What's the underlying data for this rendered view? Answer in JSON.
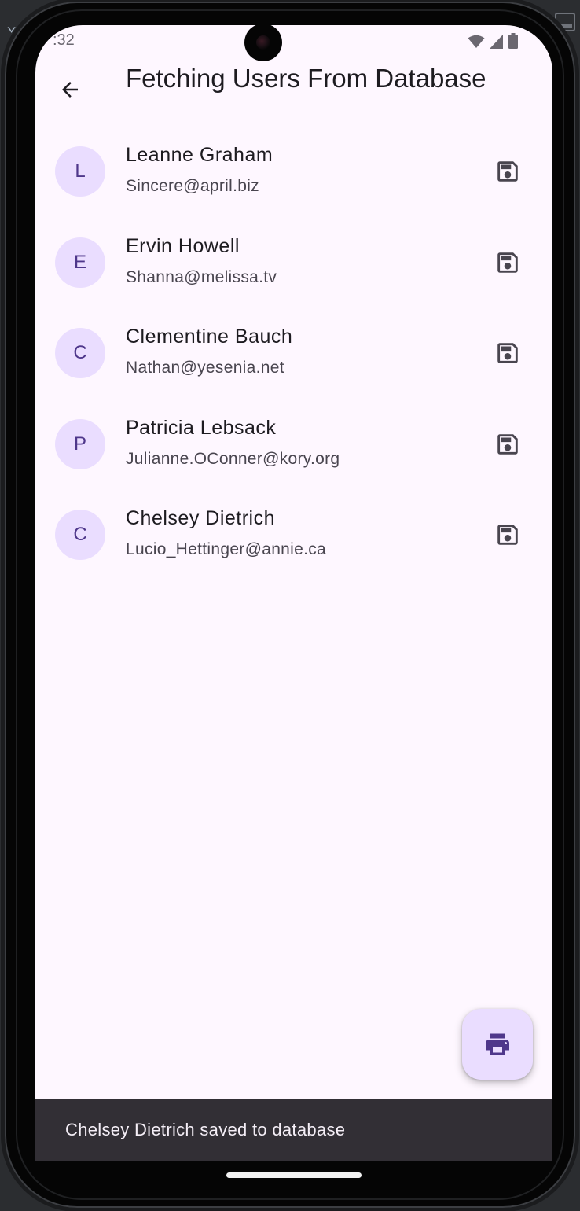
{
  "status_bar": {
    "time": ":32",
    "icons": [
      "wifi-icon",
      "cellular-signal-icon",
      "battery-icon"
    ]
  },
  "app_bar": {
    "back_icon": "arrow-back-icon",
    "title": "Fetching Users From Database"
  },
  "users": [
    {
      "initial": "L",
      "name": "Leanne Graham",
      "email": "Sincere@april.biz",
      "action_icon": "save-icon"
    },
    {
      "initial": "E",
      "name": "Ervin Howell",
      "email": "Shanna@melissa.tv",
      "action_icon": "save-icon"
    },
    {
      "initial": "C",
      "name": "Clementine Bauch",
      "email": "Nathan@yesenia.net",
      "action_icon": "save-icon"
    },
    {
      "initial": "P",
      "name": "Patricia Lebsack",
      "email": "Julianne.OConner@kory.org",
      "action_icon": "save-icon"
    },
    {
      "initial": "C",
      "name": "Chelsey Dietrich",
      "email": "Lucio_Hettinger@annie.ca",
      "action_icon": "save-icon"
    }
  ],
  "fab": {
    "icon": "print-icon"
  },
  "snackbar": {
    "message": "Chelsey Dietrich saved to database"
  },
  "colors": {
    "background": "#fef7ff",
    "avatar_bg": "#eaddff",
    "avatar_text": "#4f378b",
    "primary_text": "#1d1b20",
    "secondary_text": "#49454f",
    "snackbar_bg": "#322f35",
    "snackbar_text": "#f5eff7"
  }
}
